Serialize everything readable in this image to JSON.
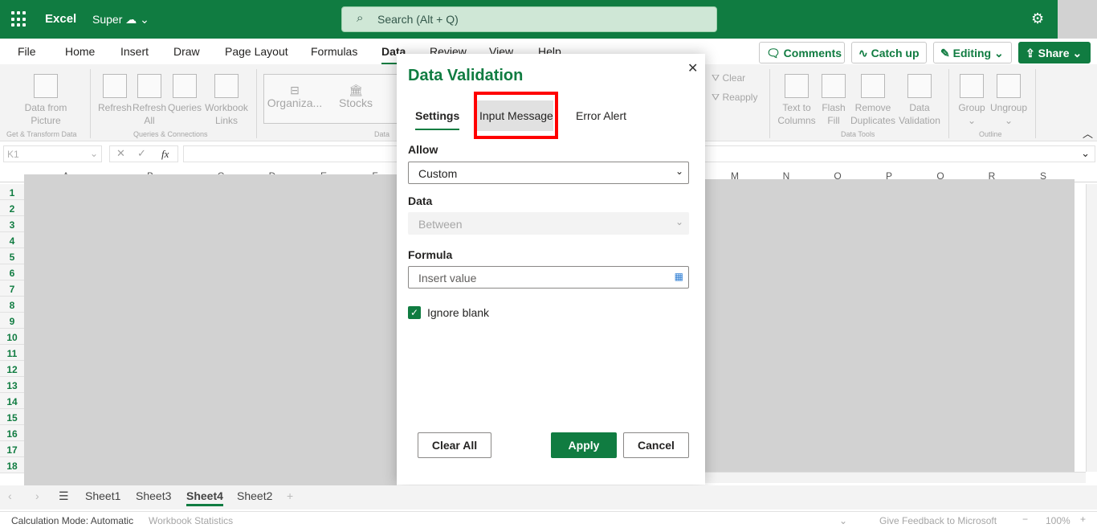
{
  "topbar": {
    "app": "Excel",
    "doc": "Super",
    "search_placeholder": "Search (Alt + Q)",
    "accent": "#107c41"
  },
  "menu": {
    "tabs": [
      "File",
      "Home",
      "Insert",
      "Draw",
      "Page Layout",
      "Formulas",
      "Data",
      "Review",
      "View",
      "Help"
    ],
    "active": "Data",
    "comments": "Comments",
    "catchup": "Catch up",
    "editing": "Editing",
    "share": "Share"
  },
  "ribbon": {
    "buttons_left": [
      {
        "l1": "Data from",
        "l2": "Picture"
      },
      {
        "l1": "Refresh",
        "l2": ""
      },
      {
        "l1": "Refresh",
        "l2": "All"
      },
      {
        "l1": "Queries",
        "l2": ""
      },
      {
        "l1": "Workbook",
        "l2": "Links"
      }
    ],
    "datatypes": [
      "Organiza...",
      "Stocks"
    ],
    "filter": [
      "Clear",
      "Reapply"
    ],
    "buttons_right": [
      {
        "l1": "Text to",
        "l2": "Columns"
      },
      {
        "l1": "Flash",
        "l2": "Fill"
      },
      {
        "l1": "Remove",
        "l2": "Duplicates"
      },
      {
        "l1": "Data",
        "l2": "Validation"
      },
      {
        "l1": "Group",
        "l2": "⌄"
      },
      {
        "l1": "Ungroup",
        "l2": "⌄"
      }
    ],
    "groups": [
      "Get & Transform Data",
      "Queries & Connections",
      "Data",
      "Data Tools",
      "Outline"
    ]
  },
  "formula_bar": {
    "name_box": "K1",
    "fx": "fx",
    "value": ""
  },
  "grid": {
    "columns_left": [
      "A",
      "B",
      "C",
      "D",
      "E",
      "F"
    ],
    "columns_right": [
      "M",
      "N",
      "O",
      "P",
      "Q",
      "R",
      "S"
    ],
    "rows": [
      "1",
      "2",
      "3",
      "4",
      "5",
      "6",
      "7",
      "8",
      "9",
      "10",
      "11",
      "12",
      "13",
      "14",
      "15",
      "16",
      "17",
      "18"
    ]
  },
  "dialog": {
    "title": "Data Validation",
    "tabs": [
      "Settings",
      "Input Message",
      "Error Alert"
    ],
    "active_tab": "Settings",
    "highlighted_tab": "Input Message",
    "allow_label": "Allow",
    "allow_value": "Custom",
    "data_label": "Data",
    "data_value": "Between",
    "formula_label": "Formula",
    "formula_placeholder": "Insert value",
    "ignore_blank": "Ignore blank",
    "ignore_blank_checked": true,
    "clear_all": "Clear All",
    "apply": "Apply",
    "cancel": "Cancel"
  },
  "sheets": {
    "tabs": [
      "Sheet1",
      "Sheet3",
      "Sheet4",
      "Sheet2"
    ],
    "active": "Sheet4"
  },
  "status": {
    "calc": "Calculation Mode: Automatic",
    "stats": "Workbook Statistics",
    "feedback": "Give Feedback to Microsoft",
    "zoom": "100%"
  }
}
